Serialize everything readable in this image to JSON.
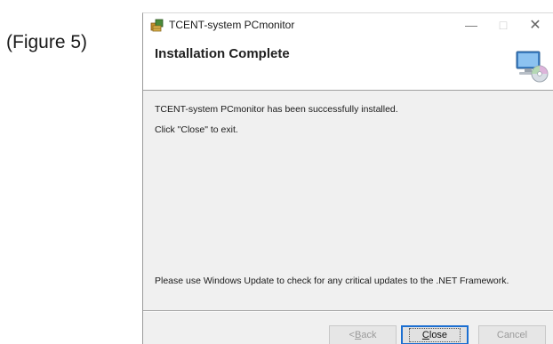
{
  "caption": "(Figure 5)",
  "window": {
    "title": "TCENT-system PCmonitor",
    "controls": {
      "minimize": "—",
      "maximize": "□",
      "close": "✕"
    }
  },
  "banner": {
    "title": "Installation Complete"
  },
  "body": {
    "line1": "TCENT-system PCmonitor has been successfully installed.",
    "line2": "Click \"Close\" to exit.",
    "line3": "Please use Windows Update to check for any critical updates to the .NET Framework."
  },
  "buttons": {
    "back": {
      "prefix": "< ",
      "mnemonic": "B",
      "rest": "ack"
    },
    "close": {
      "mnemonic": "C",
      "rest": "lose"
    },
    "cancel": "Cancel"
  },
  "colors": {
    "focus_border": "#1c6fd1",
    "dialog_bg": "#f0f0f0"
  }
}
